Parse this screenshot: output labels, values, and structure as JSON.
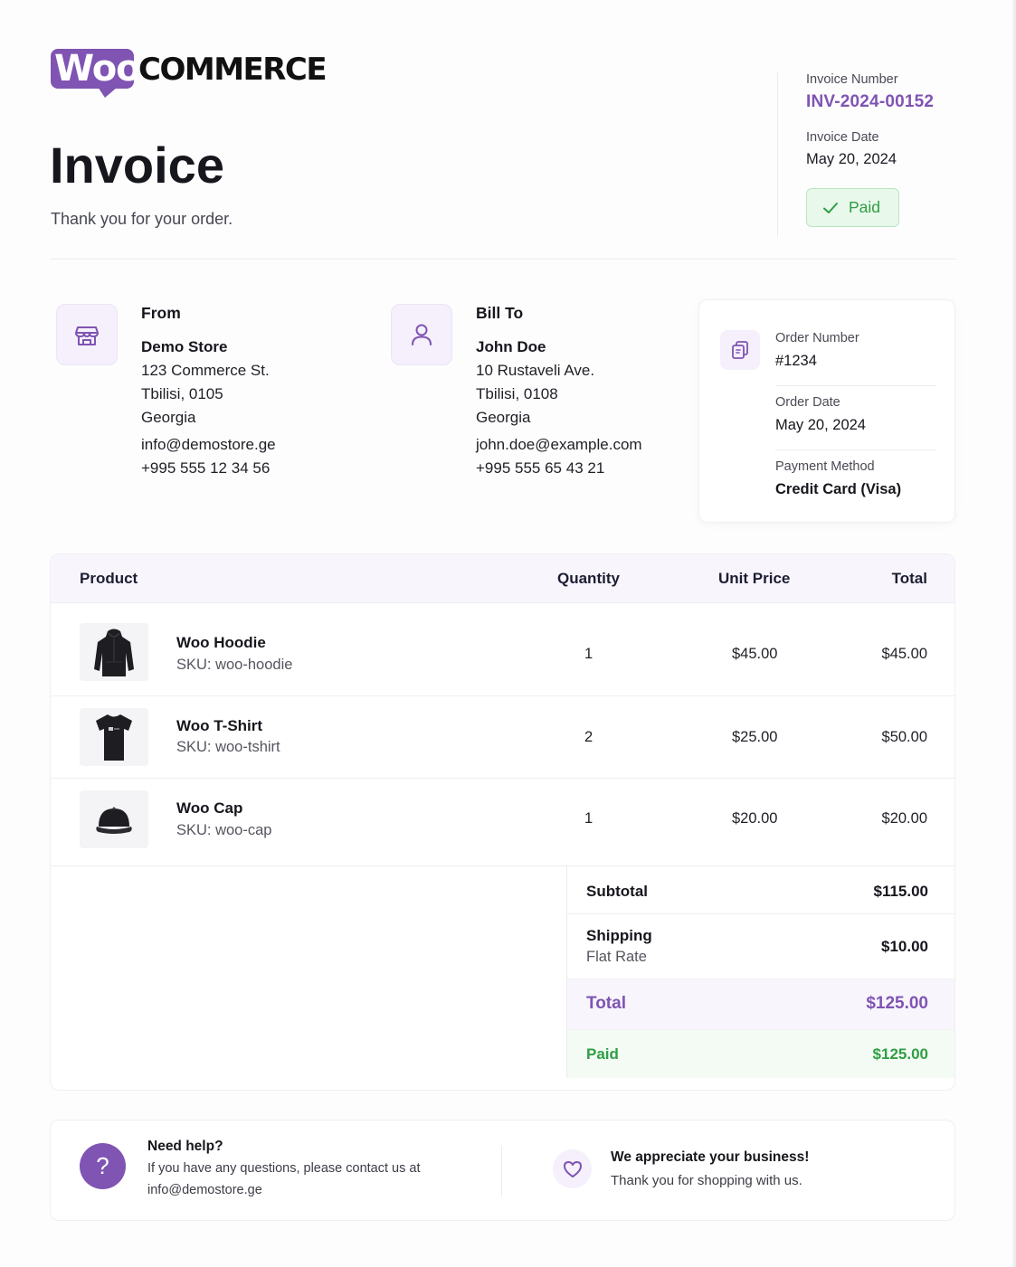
{
  "brand": {
    "logo_woo": "Woo",
    "logo_commerce": "COMMERCE",
    "accent": "#7f54b3"
  },
  "header": {
    "title": "Invoice",
    "subtitle": "Thank you for your order.",
    "invoice_number_label": "Invoice Number",
    "invoice_number": "INV-2024-00152",
    "invoice_date_label": "Invoice Date",
    "invoice_date": "May 20, 2024",
    "status": "Paid",
    "status_color": "#2f9e44"
  },
  "from": {
    "heading": "From",
    "icon": "store-icon",
    "name": "Demo Store",
    "address_line1": "123 Commerce St.",
    "address_line2": "Tbilisi, 0105",
    "country": "Georgia",
    "email": "info@demostore.ge",
    "phone": "+995 555 12 34 56"
  },
  "bill_to": {
    "heading": "Bill To",
    "icon": "user-icon",
    "name": "John Doe",
    "address_line1": "10 Rustaveli Ave.",
    "address_line2": "Tbilisi, 0108",
    "country": "Georgia",
    "email": "john.doe@example.com",
    "phone": "+995 555 65 43 21"
  },
  "order": {
    "icon": "copy-icon",
    "number_label": "Order Number",
    "number": "#1234",
    "date_label": "Order Date",
    "date": "May 20, 2024",
    "payment_label": "Payment Method",
    "payment": "Credit Card (Visa)"
  },
  "table": {
    "columns": {
      "product": "Product",
      "quantity": "Quantity",
      "unit_price": "Unit Price",
      "total": "Total"
    },
    "rows": [
      {
        "name": "Woo Hoodie",
        "sku": "SKU: woo-hoodie",
        "qty": "1",
        "unit_price": "$45.00",
        "total": "$45.00",
        "icon": "hoodie-icon"
      },
      {
        "name": "Woo T-Shirt",
        "sku": "SKU: woo-tshirt",
        "qty": "2",
        "unit_price": "$25.00",
        "total": "$50.00",
        "icon": "tshirt-icon"
      },
      {
        "name": "Woo Cap",
        "sku": "SKU: woo-cap",
        "qty": "1",
        "unit_price": "$20.00",
        "total": "$20.00",
        "icon": "cap-icon"
      }
    ]
  },
  "totals": {
    "subtotal_label": "Subtotal",
    "subtotal": "$115.00",
    "shipping_label": "Shipping",
    "shipping_method": "Flat Rate",
    "shipping": "$10.00",
    "total_label": "Total",
    "total": "$125.00",
    "paid_label": "Paid",
    "paid": "$125.00"
  },
  "footer": {
    "help_title": "Need help?",
    "help_body": "If you have any questions, please contact us at",
    "help_email": "info@demostore.ge",
    "thanks_title": "We appreciate your business!",
    "thanks_body": "Thank you for shopping with us."
  }
}
